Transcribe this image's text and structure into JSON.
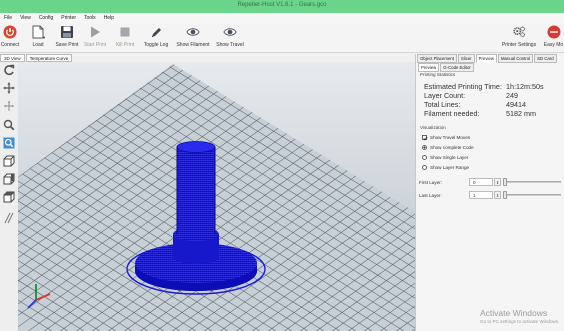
{
  "window": {
    "title": "Repetier-Host V1.6.1 - Gears.gco"
  },
  "menu": [
    "File",
    "View",
    "Config",
    "Printer",
    "Tools",
    "Help"
  ],
  "toolbar": {
    "connect": "Connect",
    "load": "Load",
    "save_print": "Save Print",
    "start_print": "Start Print",
    "kill_print": "Kill Print",
    "toggle_log": "Toggle Log",
    "show_filament": "Show Filament",
    "show_travel": "Show Travel",
    "printer_settings": "Printer Settings",
    "easy_mode": "Easy Mo"
  },
  "left_tabs": [
    "3D View",
    "Temperature Curve"
  ],
  "right_tabs": [
    "Object Placement",
    "Slicer",
    "Preview",
    "Manual Control",
    "SD Card"
  ],
  "right_tabs_active": "Preview",
  "sub_tabs": [
    "Preview",
    "G-Code Editor"
  ],
  "printing_statistics": {
    "title": "Printing Statistics",
    "rows": [
      {
        "label": "Estimated Printing Time:",
        "value": "1h:12m:50s"
      },
      {
        "label": "Layer Count:",
        "value": "249"
      },
      {
        "label": "Total Lines:",
        "value": "49414"
      },
      {
        "label": "Filament needed:",
        "value": "5182 mm"
      }
    ]
  },
  "visualization": {
    "title": "Visualization",
    "show_travel_moves": "Show Travel Moves",
    "show_complete_code": "Show complete Code",
    "show_single_layer": "Show Single Layer",
    "show_layer_range": "Show Layer Range",
    "first_layer_label": "First Layer:",
    "first_layer_value": "0",
    "last_layer_label": "Last Layer:",
    "last_layer_value": "1"
  },
  "watermark": {
    "line1": "Activate Windows",
    "line2": "Go to PC settings to activate Windows."
  },
  "colors": {
    "titlebar": "#6ad48b",
    "model": "#1a1ae0",
    "viewport_bg": "#cfd6dc",
    "grid_line": "#5e6268"
  }
}
